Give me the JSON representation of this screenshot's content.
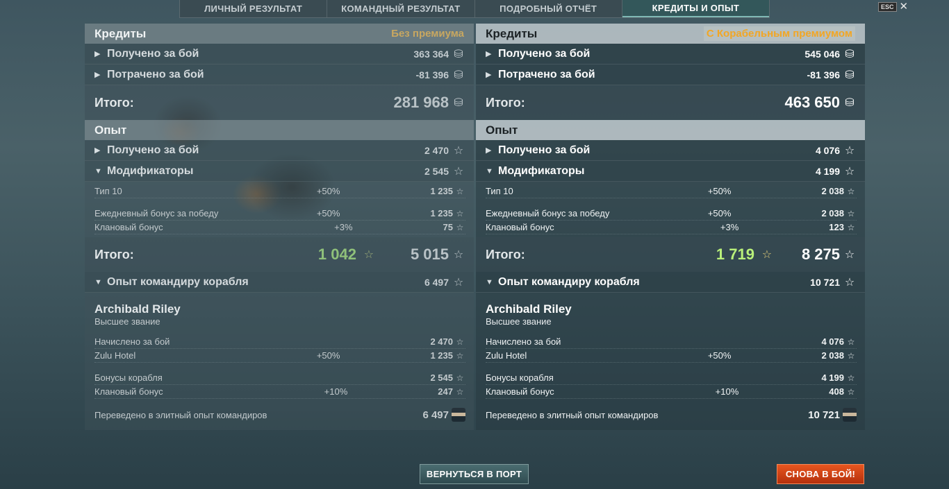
{
  "tabs": [
    "ЛИЧНЫЙ РЕЗУЛЬТАТ",
    "КОМАНДНЫЙ РЕЗУЛЬТАТ",
    "ПОДРОБНЫЙ ОТЧЁТ",
    "КРЕДИТЫ И ОПЫТ"
  ],
  "active_tab": "КРЕДИТЫ И ОПЫТ",
  "esc_label": "ESC",
  "panels": [
    {
      "credits_title": "Кредиты",
      "credits_sub": "Без премиума",
      "earned_label": "Получено за бой",
      "earned_value": "363 364",
      "spent_label": "Потрачено за бой",
      "spent_value": "-81 396",
      "total_label": "Итого:",
      "credits_total": "281 968",
      "exp_title": "Опыт",
      "exp_earned_label": "Получено за бой",
      "exp_earned_value": "2 470",
      "modifiers_label": "Модификаторы",
      "modifiers_value": "2 545",
      "mods": [
        {
          "name": "Тип 10",
          "pct": "+50%",
          "value": "1 235"
        },
        {
          "name": "Ежедневный бонус за победу",
          "pct": "+50%",
          "value": "1 235"
        },
        {
          "name": "Клановый бонус",
          "pct": "+3%",
          "value": "75"
        }
      ],
      "exp_total_label": "Итого:",
      "exp_total_free": "1 042",
      "exp_total": "5 015",
      "cmdr_label": "Опыт командиру корабля",
      "cmdr_value": "6 497",
      "cmdr_name": "Archibald Riley",
      "cmdr_rank": "Высшее звание",
      "cmdr_rows": [
        {
          "name": "Начислено за бой",
          "pct": "",
          "value": "2 470"
        },
        {
          "name": "Zulu Hotel",
          "pct": "+50%",
          "value": "1 235"
        },
        {
          "name": "Бонусы корабля",
          "pct": "",
          "value": "2 545"
        },
        {
          "name": "Клановый бонус",
          "pct": "+10%",
          "value": "247"
        }
      ],
      "elite_label": "Переведено в элитный опыт командиров",
      "elite_value": "6 497"
    },
    {
      "credits_title": "Кредиты",
      "credits_sub": "С Корабельным премиумом",
      "earned_label": "Получено за бой",
      "earned_value": "545 046",
      "spent_label": "Потрачено за бой",
      "spent_value": "-81 396",
      "total_label": "Итого:",
      "credits_total": "463 650",
      "exp_title": "Опыт",
      "exp_earned_label": "Получено за бой",
      "exp_earned_value": "4 076",
      "modifiers_label": "Модификаторы",
      "modifiers_value": "4 199",
      "mods": [
        {
          "name": "Тип 10",
          "pct": "+50%",
          "value": "2 038"
        },
        {
          "name": "Ежедневный бонус за победу",
          "pct": "+50%",
          "value": "2 038"
        },
        {
          "name": "Клановый бонус",
          "pct": "+3%",
          "value": "123"
        }
      ],
      "exp_total_label": "Итого:",
      "exp_total_free": "1 719",
      "exp_total": "8 275",
      "cmdr_label": "Опыт командиру корабля",
      "cmdr_value": "10 721",
      "cmdr_name": "Archibald Riley",
      "cmdr_rank": "Высшее звание",
      "cmdr_rows": [
        {
          "name": "Начислено за бой",
          "pct": "",
          "value": "4 076"
        },
        {
          "name": "Zulu Hotel",
          "pct": "+50%",
          "value": "2 038"
        },
        {
          "name": "Бонусы корабля",
          "pct": "",
          "value": "4 199"
        },
        {
          "name": "Клановый бонус",
          "pct": "+10%",
          "value": "408"
        }
      ],
      "elite_label": "Переведено в элитный опыт командиров",
      "elite_value": "10 721"
    }
  ],
  "buttons": {
    "port": "ВЕРНУТЬСЯ В ПОРТ",
    "battle": "СНОВА В БОЙ!"
  },
  "icons": {
    "credits": "coin-stack-icon",
    "experience": "star-icon",
    "free_exp": "gold-star-icon",
    "commander": "commander-avatar-icon"
  },
  "colors": {
    "premium_accent": "#f2a624",
    "free_exp_green": "#b9f07a",
    "battle_button": "#d9441a"
  }
}
